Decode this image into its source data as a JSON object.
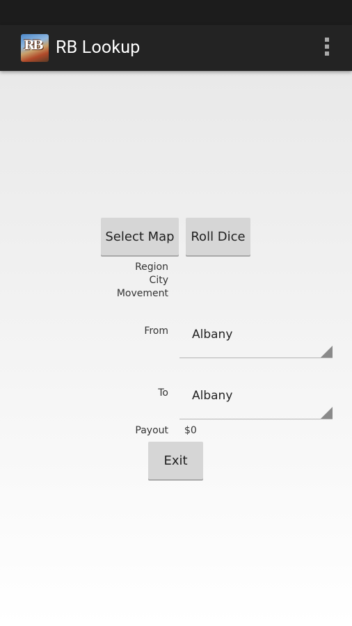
{
  "action_bar": {
    "title": "RB Lookup",
    "icon": "rb-logo-icon",
    "overflow_icon": "overflow-menu-icon"
  },
  "buttons": {
    "select_map": "Select Map",
    "roll_dice": "Roll Dice",
    "exit": "Exit"
  },
  "info": {
    "region_label": "Region",
    "city_label": "City",
    "movement_label": "Movement"
  },
  "from": {
    "label": "From",
    "selected": "Albany"
  },
  "to": {
    "label": "To",
    "selected": "Albany"
  },
  "payout": {
    "label": "Payout",
    "value": "$0"
  }
}
